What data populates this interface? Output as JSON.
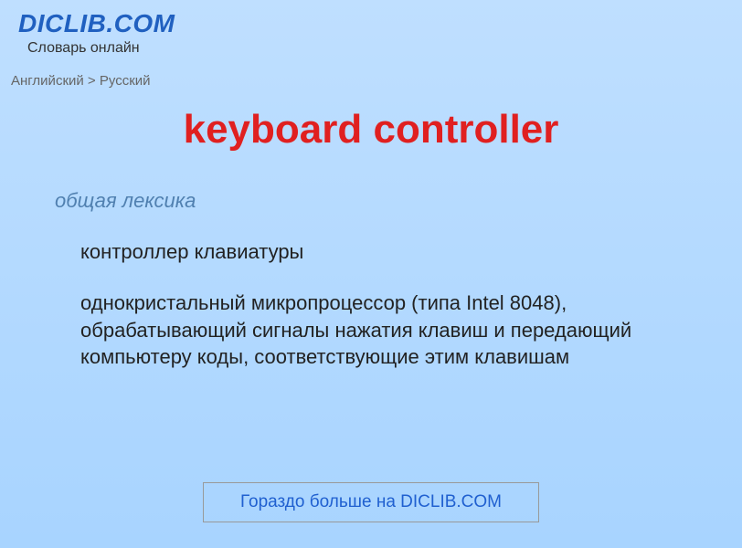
{
  "header": {
    "logo": "DICLIB.COM",
    "tagline": "Словарь онлайн"
  },
  "breadcrumb": "Английский > Русский",
  "term": "keyboard controller",
  "category": "общая лексика",
  "definition_1": "контроллер клавиатуры",
  "definition_2": "однокристальный микропроцессор (типа Intel 8048), обрабатывающий сигналы нажатия клавиш и передающий компьютеру коды, соответствующие этим клавишам",
  "footer_link": "Гораздо больше на DICLIB.COM"
}
